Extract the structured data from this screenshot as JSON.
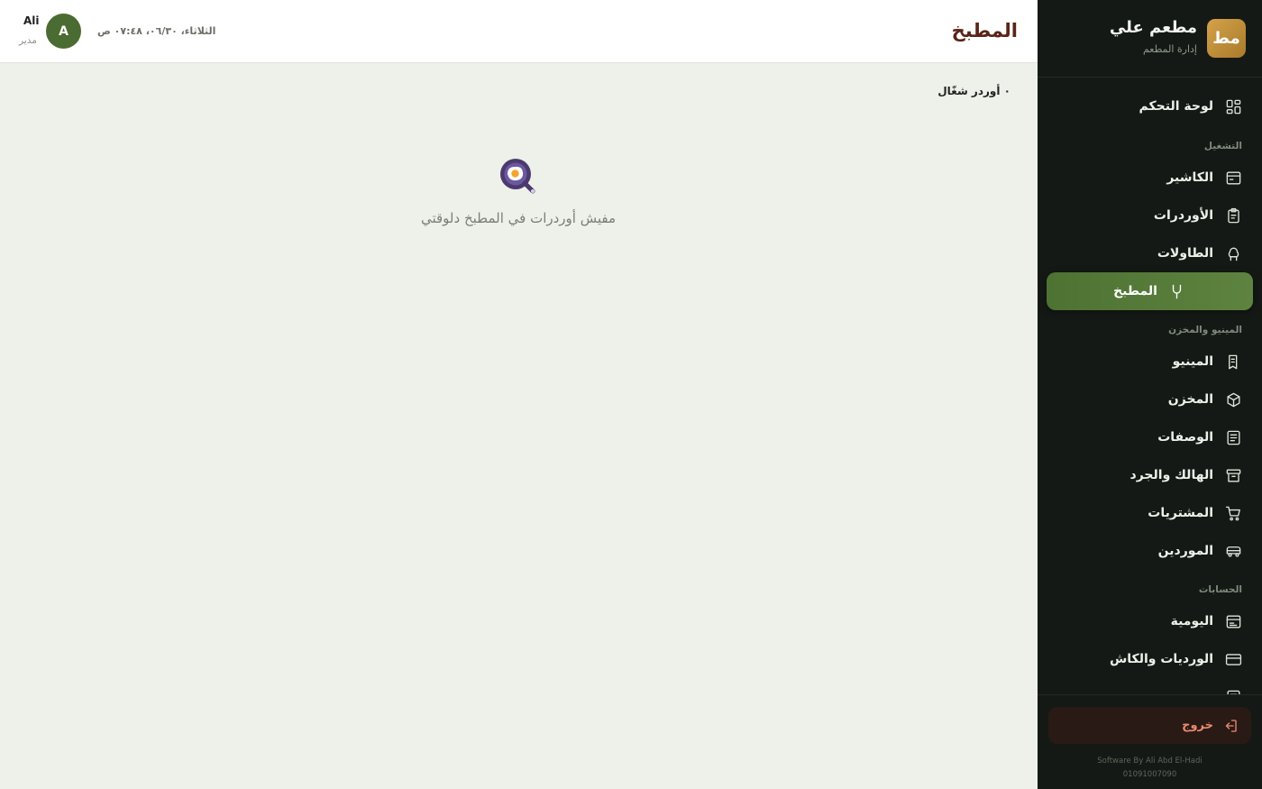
{
  "brand": {
    "logo_text": "مط",
    "name": "مطعم علي",
    "subtitle": "إدارة المطعم"
  },
  "sidebar": {
    "dashboard": "لوحة التحكم",
    "section_operation": "التشغيل",
    "cashier": "الكاشير",
    "orders": "الأوردرات",
    "tables": "الطاولات",
    "kitchen": "المطبخ",
    "section_menu": "المينيو والمخزن",
    "menu": "المينيو",
    "inventory": "المخزن",
    "recipes": "الوصفات",
    "waste": "الهالك والجرد",
    "purchases": "المشتريات",
    "suppliers": "الموردين",
    "section_accounts": "الحسابات",
    "daily": "اليومية",
    "shifts": "الورديات والكاش",
    "logout": "خروج",
    "credit_line1": "Software By Ali Abd El-Hadi",
    "credit_line2": "01091007090",
    "accent_color": "#5e8340"
  },
  "header": {
    "title": "المطبخ",
    "datetime": "الثلاثاء، ٠٦/٣٠، ٠٧:٤٨ ص",
    "avatar_letter": "A",
    "user_name": "Ali",
    "user_role": "مدير"
  },
  "main": {
    "orders_count": "٠ أوردر شغّال",
    "empty_message": "مفيش أوردرات في المطبخ دلوقتي",
    "empty_icon": "frying-pan-egg-icon"
  }
}
